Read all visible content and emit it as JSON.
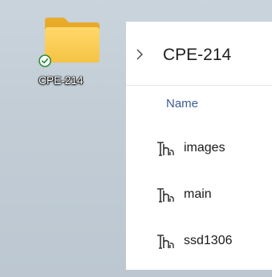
{
  "desktop": {
    "icon": {
      "icon_name": "folder-icon",
      "badge_icon": "sync-check-icon",
      "label": "CPE-214",
      "folder_color": "#f5c84e",
      "badge_color": "#2e8b3a"
    }
  },
  "explorer": {
    "breadcrumb": {
      "chevron_icon": "chevron-right-icon",
      "current": "CPE-214"
    },
    "column_header": "Name",
    "files": [
      {
        "name": "images",
        "icon": "file-icon"
      },
      {
        "name": "main",
        "icon": "file-icon"
      },
      {
        "name": "ssd1306",
        "icon": "file-icon"
      }
    ]
  }
}
